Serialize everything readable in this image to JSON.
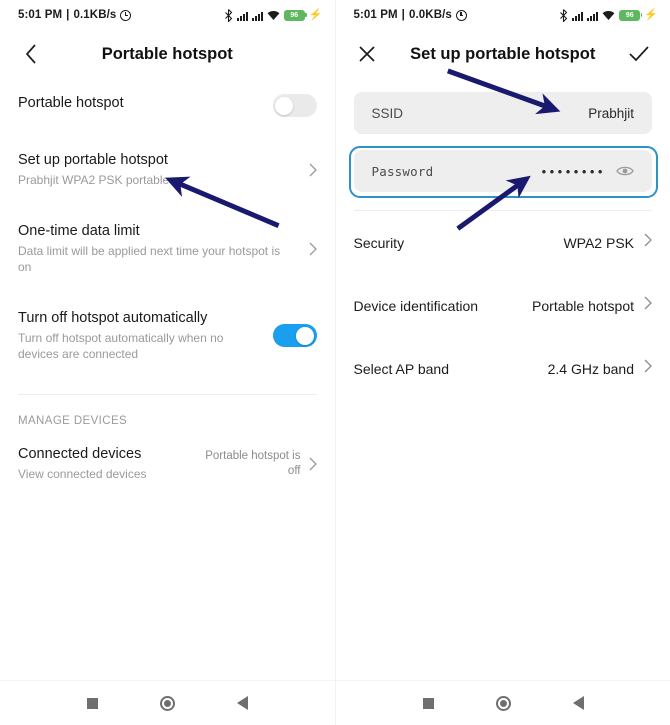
{
  "status_bar": {
    "left_panel": {
      "time": "5:01 PM",
      "separator": "|",
      "net_speed": "0.1KB/s",
      "alarm_icon": "alarm-clock-icon"
    },
    "right_panel": {
      "time": "5:01 PM",
      "separator": "|",
      "net_speed": "0.0KB/s",
      "alarm_icon": "alarm-clock-icon"
    },
    "icons": [
      "bluetooth-icon",
      "signal-icon",
      "signal-icon",
      "wifi-icon",
      "battery-icon",
      "charging-bolt-icon"
    ],
    "battery_level": "96",
    "battery_color": "#5fb85f"
  },
  "left_screen": {
    "appbar": {
      "back_icon": "back-chevron-icon",
      "title": "Portable hotspot"
    },
    "rows": [
      {
        "title": "Portable hotspot",
        "subtitle": "",
        "toggle": "off"
      },
      {
        "title": "Set up portable hotspot",
        "subtitle": "Prabhjit WPA2 PSK portable",
        "chevron": "chevron-right-icon"
      },
      {
        "title": "One-time data limit",
        "subtitle": "Data limit will be applied next time your hotspot is on",
        "chevron": "chevron-right-icon"
      },
      {
        "title": "Turn off hotspot automatically",
        "subtitle": "Turn off hotspot automatically when no devices are connected",
        "toggle": "on"
      }
    ],
    "section_header": "MANAGE DEVICES",
    "connected": {
      "title": "Connected devices",
      "subtitle": "View connected devices",
      "value": "Portable hotspot is off",
      "chevron": "chevron-right-icon"
    }
  },
  "right_screen": {
    "appbar": {
      "close_icon": "close-x-icon",
      "title": "Set up portable hotspot",
      "confirm_icon": "check-icon"
    },
    "ssid_field": {
      "label": "SSID",
      "value": "Prabhjit"
    },
    "password_field": {
      "label": "Password",
      "value": "••••••••",
      "reveal_icon": "eye-icon",
      "highlight_color": "#2e93c4"
    },
    "rows": [
      {
        "label": "Security",
        "value": "WPA2 PSK",
        "chevron": "chevron-right-icon"
      },
      {
        "label": "Device identification",
        "value": "Portable hotspot",
        "chevron": "chevron-right-icon"
      },
      {
        "label": "Select AP band",
        "value": "2.4 GHz band",
        "chevron": "chevron-right-icon"
      }
    ]
  },
  "nav_bar": {
    "recents_icon": "square-recents-icon",
    "home_icon": "circle-home-icon",
    "back_icon": "triangle-back-icon"
  },
  "annotations": {
    "arrow_color": "#191970",
    "count": 3
  },
  "toggle_colors": {
    "on": "#1a9ef0",
    "off": "#eaeaea"
  }
}
